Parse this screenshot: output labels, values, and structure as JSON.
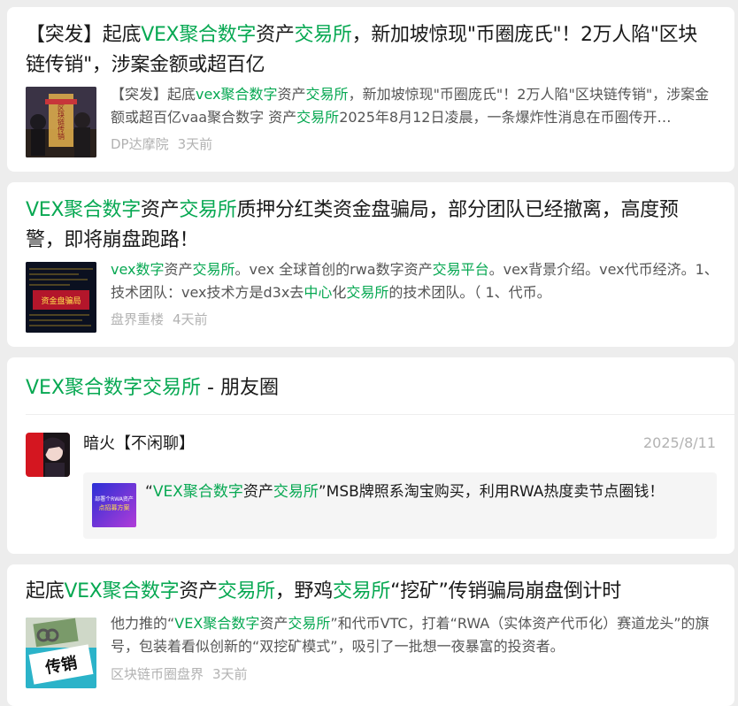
{
  "articles": [
    {
      "title_parts": [
        "【突发】起底",
        "VEX聚合数字",
        "资产",
        "交易所",
        "，新加坡惊现\"币圈庞氏\"！2万人陷\"区块链传销\"，涉案金额或超百亿"
      ],
      "summary_parts": [
        "【突发】起底",
        "vex聚合数字",
        "资产",
        "交易所",
        "，新加坡惊现\"币圈庞氏\"！2万人陷\"区块链传销\"，涉案金额或超百亿vaa聚合数字 资产",
        "交易所",
        "2025年8月12日凌晨，一条爆炸性消息在币圈传开…"
      ],
      "source": "DP达摩院",
      "time": "3天前"
    },
    {
      "title_parts": [
        "VEX聚合数字",
        "资产",
        "交易所",
        "质押分红类资金盘骗局，部分团队已经撤离，高度预警，即将崩盘跑路！"
      ],
      "summary_parts": [
        "vex数字",
        "资产",
        "交易所",
        "。vex 全球首创的rwa数字资产",
        "交易平台",
        "。vex背景介绍。vex代币经济。1、技术团队：vex技术方是d3x去",
        "中心",
        "化",
        "交易所",
        "的技术团队。（ 1、代币。"
      ],
      "source": "盘界重楼",
      "time": "4天前"
    },
    {
      "title_parts": [
        "起底",
        "VEX聚合数字",
        "资产",
        "交易所",
        "，野鸡",
        "交易所",
        "“挖矿”传销骗局崩盘倒计时"
      ],
      "summary_parts": [
        "他力推的“",
        "VEX聚合数字",
        "资产",
        "交易所",
        "”和代币VTC，打着“RWA（实体资产代币化）赛道龙头”的旗号，包装着看似创新的“双挖矿模式”，吸引了一批想一夜暴富的投资者。"
      ],
      "source": "区块链币圈盘界",
      "time": "3天前"
    }
  ],
  "moments": {
    "title_highlight": "VEX聚合数字交易所",
    "title_rest": " - 朋友圈",
    "author": "暗火【不闲聊】",
    "date": "2025/8/11",
    "share_parts": [
      "“",
      "VEX聚合数字",
      "资产",
      "交易所",
      "”MSB牌照系淘宝购买，利用RWA热度卖节点圈钱！"
    ],
    "share_thumb_text": [
      "部署个RWA资产",
      "点招募方案"
    ]
  },
  "thumbs": {
    "a1_text": "区块链传销",
    "a2_text": "资金盘骗局",
    "a3_text": "传销"
  },
  "colors": {
    "highlight": "#07a852",
    "background": "#ededed"
  }
}
